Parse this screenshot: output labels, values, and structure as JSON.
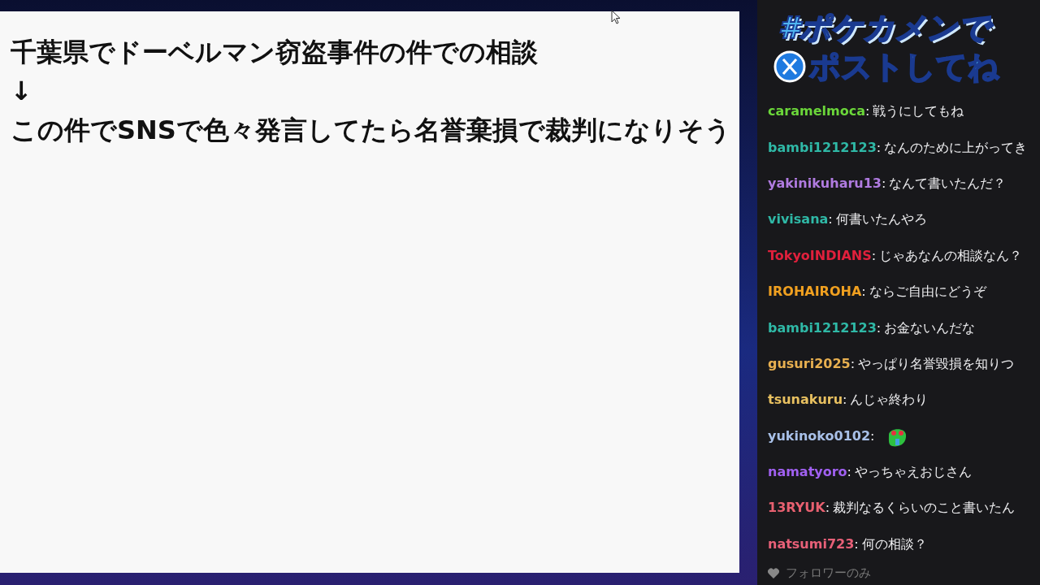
{
  "whiteboard": {
    "lines": [
      "千葉県でドーベルマン窃盗事件の件での相談",
      "↓",
      "この件でSNSで色々発言してたら名誉棄損で裁判になりそう"
    ]
  },
  "overlay": {
    "lines": [
      "#ポケカメンで",
      "ポストしてね"
    ]
  },
  "chat": {
    "messages": [
      {
        "kind": "text",
        "user": "caramelmoca",
        "color": "#6bd63a",
        "text": "戦うにしてもね"
      },
      {
        "kind": "text",
        "user": "bambi1212123",
        "color": "#2fb8a6",
        "text": "なんのために上がってき"
      },
      {
        "kind": "text",
        "user": "yakinikuharu13",
        "color": "#b07be0",
        "text": "なんて書いたんだ？"
      },
      {
        "kind": "text",
        "user": "vivisana",
        "color": "#2fb8a6",
        "text": "何書いたんやろ"
      },
      {
        "kind": "text",
        "user": "TokyoINDIANS",
        "color": "#e0203c",
        "text": "じゃあなんの相談なん？"
      },
      {
        "kind": "text",
        "user": "IROHAIROHA",
        "color": "#f0a020",
        "text": "ならご自由にどうぞ"
      },
      {
        "kind": "text",
        "user": "bambi1212123",
        "color": "#2fb8a6",
        "text": "お金ないんだな"
      },
      {
        "kind": "text",
        "user": "gusuri2025",
        "color": "#e8b050",
        "text": "やっぱり名誉毀損を知りつ"
      },
      {
        "kind": "text",
        "user": "tsunakuru",
        "color": "#e8c060",
        "text": "んじゃ終わり"
      },
      {
        "kind": "emote",
        "user": "yukinoko0102",
        "color": "#a8c0e8"
      },
      {
        "kind": "text",
        "user": "namatyoro",
        "color": "#a060f0",
        "text": "やっちゃえおじさん"
      },
      {
        "kind": "text",
        "user": "13RYUK",
        "color": "#e86070",
        "text": "裁判なるくらいのこと書いたん"
      },
      {
        "kind": "text",
        "user": "natsumi723",
        "color": "#e86078",
        "text": "何の相談？"
      }
    ],
    "separator": ":",
    "footer": "フォロワーのみ"
  }
}
